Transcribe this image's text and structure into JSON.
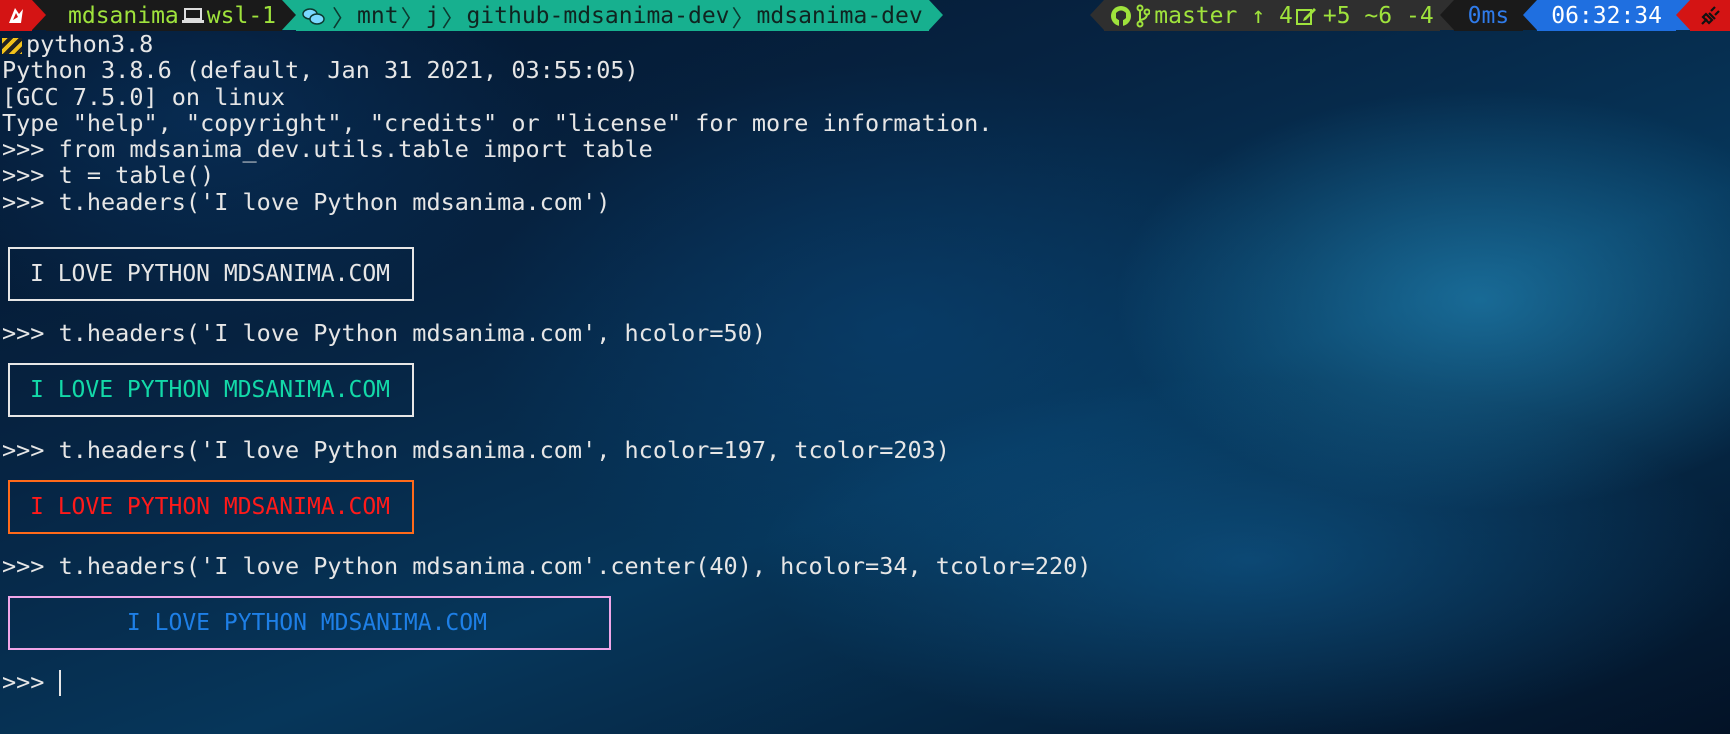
{
  "prompt_bar": {
    "user": "mdsanima",
    "host": "wsl-1",
    "path_segments": [
      "mnt",
      "j",
      "github-mdsanima-dev",
      "mdsanima-dev"
    ],
    "git_branch": "master",
    "git_ahead": "↑ 4",
    "git_changes": "+5 ~6 -4",
    "exec_time": "0ms",
    "clock": "06:32:34"
  },
  "terminal": {
    "venv_name": "python3.8",
    "banner": [
      "Python 3.8.6 (default, Jan 31 2021, 03:55:05)",
      "[GCC 7.5.0] on linux",
      "Type \"help\", \"copyright\", \"credits\" or \"license\" for more information."
    ],
    "commands": [
      ">>> from mdsanima_dev.utils.table import table",
      ">>> t = table()",
      ">>> t.headers('I love Python mdsanima.com')",
      ">>> t.headers('I love Python mdsanima.com', hcolor=50)",
      ">>> t.headers('I love Python mdsanima.com', hcolor=197, tcolor=203)",
      ">>> t.headers('I love Python mdsanima.com'.center(40), hcolor=34, tcolor=220)"
    ],
    "outputs": [
      {
        "text": "I LOVE PYTHON MDSANIMA.COM",
        "text_color": "#e6e6e6",
        "border_color": "#e6e6e6"
      },
      {
        "text": "I LOVE PYTHON MDSANIMA.COM",
        "text_color": "#13d9a8",
        "border_color": "#e6e6e6"
      },
      {
        "text": "I LOVE PYTHON MDSANIMA.COM",
        "text_color": "#ff1a1a",
        "border_color": "#ff6a1a"
      },
      {
        "text": "       I LOVE PYTHON MDSANIMA.COM",
        "text_color": "#1e7fe6",
        "border_color": "#f0a6e8"
      }
    ],
    "final_prompt": ">>> "
  },
  "colors": {
    "os_red": "#d41414",
    "path_teal": "#17b08f",
    "git_green": "#9fe33c",
    "clock_blue": "#1f6fe0"
  },
  "icons": {
    "os": "debian-logo-icon",
    "host": "laptop-icon",
    "folder": "folder-icon",
    "git": "github-icon",
    "branch": "git-branch-icon",
    "changes": "edit-icon",
    "venv": "python-venv-icon",
    "right": "plug-icon"
  }
}
